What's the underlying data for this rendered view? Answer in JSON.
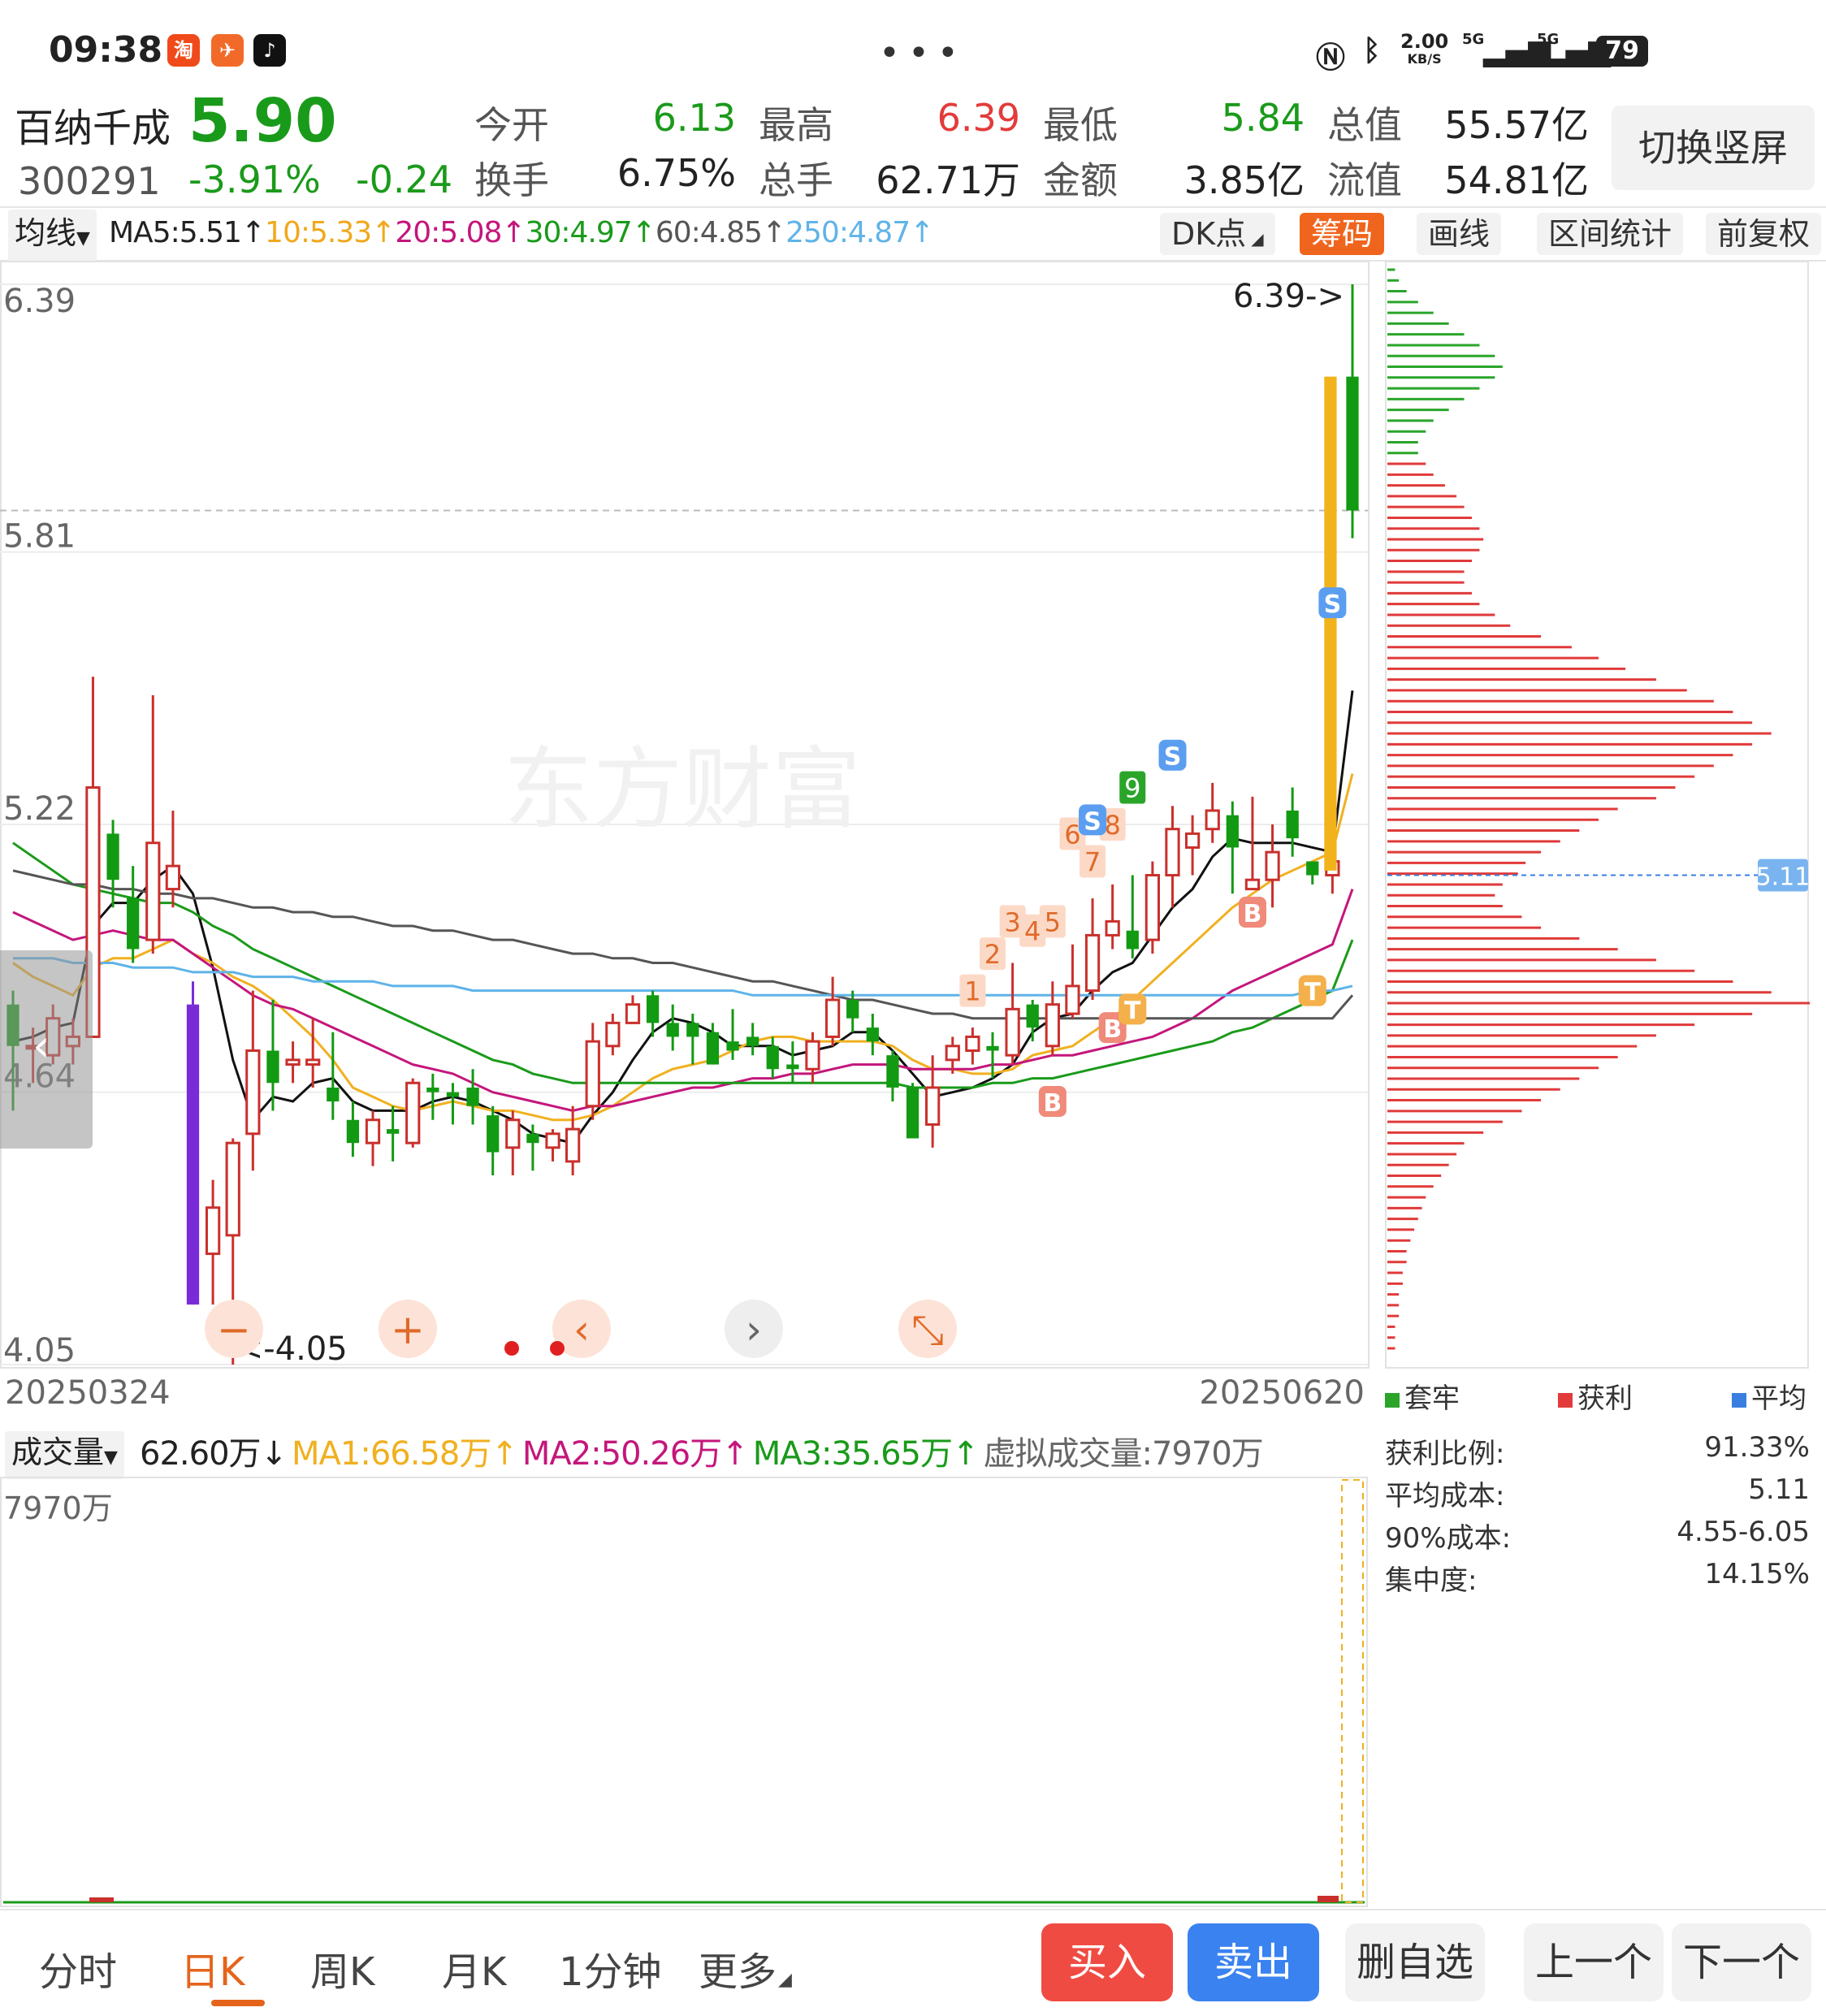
{
  "status_bar": {
    "time": "09:38",
    "app_icons": [
      "taobao-icon",
      "fliggy-icon",
      "douyin-icon"
    ],
    "net_speed_value": "2.00",
    "net_speed_unit": "KB/S",
    "signal_label_1": "5G",
    "signal_label_2": "5G",
    "battery": "79"
  },
  "quote": {
    "name": "百纳千成",
    "code": "300291",
    "price": "5.90",
    "change_pct": "-3.91%",
    "change": "-0.24",
    "rows": [
      [
        {
          "label": "今开",
          "value": "6.13",
          "color": "#1a9a1a"
        },
        {
          "label": "最高",
          "value": "6.39",
          "color": "#e33b3b"
        },
        {
          "label": "最低",
          "value": "5.84",
          "color": "#1a9a1a"
        },
        {
          "label": "总值",
          "value": "55.57亿",
          "color": "#222"
        }
      ],
      [
        {
          "label": "换手",
          "value": "6.75%",
          "color": "#222"
        },
        {
          "label": "总手",
          "value": "62.71万",
          "color": "#222"
        },
        {
          "label": "金额",
          "value": "3.85亿",
          "color": "#222"
        },
        {
          "label": "流值",
          "value": "54.81亿",
          "color": "#222"
        }
      ]
    ],
    "switch_button": "切换竖屏"
  },
  "ma_bar": {
    "selector": "均线",
    "items": [
      {
        "text": "MA5:5.51↑",
        "color": "#222"
      },
      {
        "text": "10:5.33↑",
        "color": "#f0a81c"
      },
      {
        "text": "20:5.08↑",
        "color": "#c4167c"
      },
      {
        "text": "30:4.97↑",
        "color": "#1a9a1a"
      },
      {
        "text": "60:4.85↑",
        "color": "#555555"
      },
      {
        "text": "250:4.87↑",
        "color": "#5fb3e8"
      }
    ],
    "tools": [
      "DK点",
      "筹码",
      "画线",
      "区间统计",
      "前复权"
    ],
    "active_tool": "筹码"
  },
  "chart_data": {
    "type": "candlestick",
    "y_ticks": [
      "6.39",
      "5.81",
      "5.22",
      "4.64",
      "4.05"
    ],
    "ylim": [
      4.05,
      6.39
    ],
    "x_start_label": "20250324",
    "x_end_label": "20250620",
    "high_marker": "6.39->",
    "low_marker": "<-4.05",
    "watermark": "东方财富",
    "candles": [
      {
        "o": 4.83,
        "c": 4.74,
        "h": 4.86,
        "l": 4.6
      },
      {
        "o": 4.74,
        "c": 4.74,
        "h": 4.78,
        "l": 4.66
      },
      {
        "o": 4.72,
        "c": 4.8,
        "h": 4.83,
        "l": 4.7
      },
      {
        "o": 4.74,
        "c": 4.76,
        "h": 4.8,
        "l": 4.7
      },
      {
        "o": 4.76,
        "c": 5.3,
        "h": 5.54,
        "l": 4.76
      },
      {
        "o": 5.2,
        "c": 5.1,
        "h": 5.23,
        "l": 5.04
      },
      {
        "o": 5.06,
        "c": 4.95,
        "h": 5.13,
        "l": 4.92
      },
      {
        "o": 4.97,
        "c": 5.18,
        "h": 5.5,
        "l": 4.94
      },
      {
        "o": 5.08,
        "c": 5.13,
        "h": 5.25,
        "l": 5.04
      },
      {
        "o": 4.83,
        "c": 4.18,
        "h": 4.88,
        "l": 4.18
      },
      {
        "o": 4.29,
        "c": 4.39,
        "h": 4.45,
        "l": 4.18
      },
      {
        "o": 4.33,
        "c": 4.53,
        "h": 4.54,
        "l": 4.05
      },
      {
        "o": 4.55,
        "c": 4.73,
        "h": 4.86,
        "l": 4.47
      },
      {
        "o": 4.73,
        "c": 4.66,
        "h": 4.84,
        "l": 4.6
      },
      {
        "o": 4.7,
        "c": 4.71,
        "h": 4.75,
        "l": 4.66
      },
      {
        "o": 4.7,
        "c": 4.71,
        "h": 4.8,
        "l": 4.65
      },
      {
        "o": 4.65,
        "c": 4.62,
        "h": 4.77,
        "l": 4.58
      },
      {
        "o": 4.58,
        "c": 4.53,
        "h": 4.62,
        "l": 4.5
      },
      {
        "o": 4.53,
        "c": 4.58,
        "h": 4.6,
        "l": 4.48
      },
      {
        "o": 4.56,
        "c": 4.55,
        "h": 4.61,
        "l": 4.49
      },
      {
        "o": 4.53,
        "c": 4.66,
        "h": 4.67,
        "l": 4.52
      },
      {
        "o": 4.65,
        "c": 4.64,
        "h": 4.68,
        "l": 4.58
      },
      {
        "o": 4.64,
        "c": 4.63,
        "h": 4.66,
        "l": 4.57
      },
      {
        "o": 4.65,
        "c": 4.61,
        "h": 4.69,
        "l": 4.57
      },
      {
        "o": 4.59,
        "c": 4.51,
        "h": 4.61,
        "l": 4.46
      },
      {
        "o": 4.52,
        "c": 4.58,
        "h": 4.6,
        "l": 4.46
      },
      {
        "o": 4.55,
        "c": 4.53,
        "h": 4.57,
        "l": 4.47
      },
      {
        "o": 4.52,
        "c": 4.55,
        "h": 4.56,
        "l": 4.49
      },
      {
        "o": 4.49,
        "c": 4.56,
        "h": 4.61,
        "l": 4.46
      },
      {
        "o": 4.61,
        "c": 4.75,
        "h": 4.79,
        "l": 4.58
      },
      {
        "o": 4.74,
        "c": 4.79,
        "h": 4.81,
        "l": 4.72
      },
      {
        "o": 4.79,
        "c": 4.83,
        "h": 4.85,
        "l": 4.79
      },
      {
        "o": 4.85,
        "c": 4.79,
        "h": 4.86,
        "l": 4.76
      },
      {
        "o": 4.79,
        "c": 4.76,
        "h": 4.83,
        "l": 4.73
      },
      {
        "o": 4.79,
        "c": 4.76,
        "h": 4.81,
        "l": 4.7
      },
      {
        "o": 4.77,
        "c": 4.7,
        "h": 4.79,
        "l": 4.7
      },
      {
        "o": 4.75,
        "c": 4.73,
        "h": 4.82,
        "l": 4.71
      },
      {
        "o": 4.76,
        "c": 4.74,
        "h": 4.79,
        "l": 4.72
      },
      {
        "o": 4.74,
        "c": 4.69,
        "h": 4.76,
        "l": 4.67
      },
      {
        "o": 4.7,
        "c": 4.69,
        "h": 4.75,
        "l": 4.66
      },
      {
        "o": 4.69,
        "c": 4.75,
        "h": 4.77,
        "l": 4.66
      },
      {
        "o": 4.76,
        "c": 4.84,
        "h": 4.89,
        "l": 4.74
      },
      {
        "o": 4.84,
        "c": 4.8,
        "h": 4.86,
        "l": 4.77
      },
      {
        "o": 4.78,
        "c": 4.75,
        "h": 4.81,
        "l": 4.72
      },
      {
        "o": 4.72,
        "c": 4.65,
        "h": 4.73,
        "l": 4.62
      },
      {
        "o": 4.65,
        "c": 4.54,
        "h": 4.66,
        "l": 4.54
      },
      {
        "o": 4.57,
        "c": 4.65,
        "h": 4.72,
        "l": 4.52
      },
      {
        "o": 4.71,
        "c": 4.74,
        "h": 4.76,
        "l": 4.68
      },
      {
        "o": 4.73,
        "c": 4.76,
        "h": 4.78,
        "l": 4.7
      },
      {
        "o": 4.74,
        "c": 4.73,
        "h": 4.77,
        "l": 4.67
      },
      {
        "o": 4.72,
        "c": 4.82,
        "h": 4.92,
        "l": 4.7
      },
      {
        "o": 4.83,
        "c": 4.78,
        "h": 4.84,
        "l": 4.75
      },
      {
        "o": 4.74,
        "c": 4.83,
        "h": 4.88,
        "l": 4.72
      },
      {
        "o": 4.81,
        "c": 4.87,
        "h": 4.96,
        "l": 4.8
      },
      {
        "o": 4.86,
        "c": 4.98,
        "h": 5.06,
        "l": 4.84
      },
      {
        "o": 4.98,
        "c": 5.01,
        "h": 5.09,
        "l": 4.95
      },
      {
        "o": 4.99,
        "c": 4.95,
        "h": 5.11,
        "l": 4.93
      },
      {
        "o": 4.97,
        "c": 5.11,
        "h": 5.14,
        "l": 4.94
      },
      {
        "o": 5.11,
        "c": 5.21,
        "h": 5.26,
        "l": 5.04
      },
      {
        "o": 5.17,
        "c": 5.2,
        "h": 5.24,
        "l": 5.11
      },
      {
        "o": 5.21,
        "c": 5.25,
        "h": 5.31,
        "l": 5.18
      },
      {
        "o": 5.24,
        "c": 5.17,
        "h": 5.27,
        "l": 5.07
      },
      {
        "o": 5.08,
        "c": 5.1,
        "h": 5.28,
        "l": 5.08
      },
      {
        "o": 5.1,
        "c": 5.16,
        "h": 5.22,
        "l": 5.04
      },
      {
        "o": 5.25,
        "c": 5.19,
        "h": 5.3,
        "l": 5.15
      },
      {
        "o": 5.14,
        "c": 5.11,
        "h": 5.13,
        "l": 5.09
      },
      {
        "o": 5.11,
        "c": 5.14,
        "h": 5.18,
        "l": 5.07
      },
      {
        "o": 6.19,
        "c": 5.9,
        "h": 6.39,
        "l": 5.84
      }
    ],
    "ma_lines": [
      {
        "name": "MA5",
        "color": "#111111",
        "values": [
          4.75,
          4.76,
          4.78,
          4.79,
          5.0,
          5.05,
          5.05,
          5.1,
          5.13,
          5.07,
          4.91,
          4.71,
          4.58,
          4.63,
          4.62,
          4.66,
          4.67,
          4.62,
          4.6,
          4.6,
          4.6,
          4.62,
          4.63,
          4.62,
          4.6,
          4.58,
          4.55,
          4.54,
          4.53,
          4.59,
          4.64,
          4.71,
          4.77,
          4.8,
          4.79,
          4.77,
          4.74,
          4.74,
          4.74,
          4.72,
          4.73,
          4.74,
          4.77,
          4.77,
          4.73,
          4.68,
          4.63,
          4.64,
          4.65,
          4.67,
          4.7,
          4.77,
          4.8,
          4.81,
          4.86,
          4.9,
          4.92,
          4.98,
          5.04,
          5.08,
          5.15,
          5.19,
          5.18,
          5.18,
          5.18,
          5.17,
          5.16,
          5.51
        ]
      },
      {
        "name": "MA10",
        "color": "#f0b020",
        "values": [
          4.92,
          4.89,
          4.87,
          4.85,
          4.91,
          4.93,
          4.93,
          4.95,
          4.97,
          4.94,
          4.92,
          4.89,
          4.87,
          4.84,
          4.8,
          4.76,
          4.71,
          4.65,
          4.63,
          4.61,
          4.6,
          4.61,
          4.62,
          4.61,
          4.6,
          4.6,
          4.59,
          4.58,
          4.58,
          4.59,
          4.61,
          4.64,
          4.67,
          4.69,
          4.7,
          4.71,
          4.73,
          4.75,
          4.76,
          4.76,
          4.75,
          4.75,
          4.75,
          4.75,
          4.74,
          4.71,
          4.69,
          4.69,
          4.68,
          4.68,
          4.69,
          4.72,
          4.73,
          4.74,
          4.77,
          4.8,
          4.84,
          4.88,
          4.92,
          4.96,
          5.0,
          5.04,
          5.07,
          5.1,
          5.12,
          5.14,
          5.16,
          5.33
        ]
      },
      {
        "name": "MA20",
        "color": "#c4167c",
        "values": [
          5.03,
          5.01,
          4.99,
          4.97,
          4.98,
          4.99,
          4.98,
          4.97,
          4.97,
          4.94,
          4.91,
          4.88,
          4.85,
          4.83,
          4.82,
          4.8,
          4.78,
          4.76,
          4.74,
          4.72,
          4.7,
          4.69,
          4.68,
          4.66,
          4.64,
          4.63,
          4.62,
          4.61,
          4.6,
          4.61,
          4.61,
          4.62,
          4.63,
          4.64,
          4.65,
          4.65,
          4.66,
          4.67,
          4.67,
          4.68,
          4.68,
          4.69,
          4.7,
          4.7,
          4.7,
          4.69,
          4.69,
          4.69,
          4.69,
          4.7,
          4.7,
          4.71,
          4.72,
          4.72,
          4.73,
          4.74,
          4.75,
          4.76,
          4.78,
          4.8,
          4.83,
          4.86,
          4.88,
          4.9,
          4.92,
          4.94,
          4.96,
          5.08
        ]
      },
      {
        "name": "MA30",
        "color": "#1a9a1a",
        "values": [
          5.18,
          5.15,
          5.12,
          5.09,
          5.08,
          5.07,
          5.06,
          5.05,
          5.05,
          5.03,
          5.0,
          4.98,
          4.95,
          4.93,
          4.91,
          4.89,
          4.87,
          4.85,
          4.83,
          4.81,
          4.79,
          4.77,
          4.75,
          4.73,
          4.71,
          4.7,
          4.68,
          4.67,
          4.66,
          4.66,
          4.66,
          4.66,
          4.66,
          4.66,
          4.66,
          4.66,
          4.66,
          4.66,
          4.66,
          4.66,
          4.66,
          4.66,
          4.66,
          4.66,
          4.66,
          4.65,
          4.65,
          4.65,
          4.65,
          4.66,
          4.66,
          4.67,
          4.67,
          4.68,
          4.69,
          4.7,
          4.71,
          4.72,
          4.73,
          4.74,
          4.75,
          4.77,
          4.78,
          4.8,
          4.82,
          4.84,
          4.86,
          4.97
        ]
      },
      {
        "name": "MA60",
        "color": "#555555",
        "values": [
          5.12,
          5.11,
          5.1,
          5.09,
          5.09,
          5.08,
          5.08,
          5.07,
          5.07,
          5.06,
          5.06,
          5.05,
          5.04,
          5.04,
          5.03,
          5.03,
          5.02,
          5.02,
          5.01,
          5.0,
          5.0,
          4.99,
          4.99,
          4.98,
          4.97,
          4.97,
          4.96,
          4.95,
          4.94,
          4.94,
          4.93,
          4.93,
          4.92,
          4.92,
          4.91,
          4.9,
          4.89,
          4.88,
          4.88,
          4.87,
          4.86,
          4.85,
          4.84,
          4.84,
          4.83,
          4.82,
          4.81,
          4.81,
          4.8,
          4.8,
          4.8,
          4.8,
          4.8,
          4.8,
          4.8,
          4.8,
          4.8,
          4.8,
          4.8,
          4.8,
          4.8,
          4.8,
          4.8,
          4.8,
          4.8,
          4.8,
          4.8,
          4.85
        ]
      },
      {
        "name": "MA250",
        "color": "#5fb3e8",
        "values": [
          4.93,
          4.93,
          4.93,
          4.92,
          4.92,
          4.92,
          4.91,
          4.91,
          4.91,
          4.9,
          4.9,
          4.9,
          4.89,
          4.89,
          4.89,
          4.88,
          4.88,
          4.88,
          4.88,
          4.87,
          4.87,
          4.87,
          4.87,
          4.86,
          4.86,
          4.86,
          4.86,
          4.86,
          4.86,
          4.86,
          4.86,
          4.86,
          4.86,
          4.86,
          4.86,
          4.86,
          4.86,
          4.85,
          4.85,
          4.85,
          4.85,
          4.85,
          4.85,
          4.85,
          4.85,
          4.85,
          4.85,
          4.85,
          4.85,
          4.85,
          4.85,
          4.85,
          4.85,
          4.85,
          4.85,
          4.85,
          4.85,
          4.85,
          4.85,
          4.85,
          4.85,
          4.85,
          4.85,
          4.85,
          4.85,
          4.86,
          4.86,
          4.87
        ]
      }
    ],
    "dk_labels": [
      {
        "i": 48,
        "text": "1",
        "price": 4.86
      },
      {
        "i": 49,
        "text": "2",
        "price": 4.94
      },
      {
        "i": 50,
        "text": "3",
        "price": 5.01
      },
      {
        "i": 51,
        "text": "4",
        "price": 4.99
      },
      {
        "i": 52,
        "text": "5",
        "price": 5.01
      },
      {
        "i": 53,
        "text": "6",
        "price": 5.2
      },
      {
        "i": 54,
        "text": "7",
        "price": 5.14
      },
      {
        "i": 55,
        "text": "8",
        "price": 5.22
      },
      {
        "i": 56,
        "text": "9",
        "price": 5.3
      }
    ],
    "signals": [
      {
        "i": 54,
        "text": "S",
        "kind": "sell",
        "price": 5.23
      },
      {
        "i": 58,
        "text": "S",
        "kind": "sell",
        "price": 5.37
      },
      {
        "i": 66,
        "text": "S",
        "kind": "sell",
        "price": 5.7
      },
      {
        "i": 52,
        "text": "B",
        "kind": "buy",
        "price": 4.62
      },
      {
        "i": 55,
        "text": "B",
        "kind": "buy",
        "price": 4.78
      },
      {
        "i": 62,
        "text": "B",
        "kind": "buy",
        "price": 5.03
      },
      {
        "i": 56,
        "text": "T",
        "kind": "t",
        "price": 4.82
      },
      {
        "i": 65,
        "text": "T",
        "kind": "t",
        "price": 4.86
      }
    ],
    "chips": {
      "avg_cost_label": "5.11",
      "profit_levels_from_top": 50,
      "values": [
        2,
        3,
        5,
        8,
        12,
        16,
        20,
        24,
        28,
        30,
        28,
        24,
        20,
        16,
        12,
        10,
        8,
        8,
        10,
        12,
        15,
        18,
        20,
        22,
        24,
        25,
        24,
        22,
        20,
        20,
        22,
        24,
        28,
        32,
        40,
        48,
        55,
        62,
        70,
        78,
        85,
        90,
        95,
        100,
        95,
        90,
        85,
        80,
        75,
        70,
        60,
        55,
        50,
        45,
        40,
        36,
        34,
        30,
        28,
        30,
        35,
        40,
        50,
        60,
        70,
        80,
        90,
        100,
        110,
        95,
        80,
        70,
        65,
        60,
        55,
        50,
        45,
        40,
        35,
        30,
        25,
        20,
        18,
        16,
        14,
        12,
        10,
        9,
        8,
        7,
        6,
        5,
        5,
        4,
        4,
        3,
        3,
        3,
        2,
        2,
        2
      ]
    }
  },
  "chart_controls": [
    "minus-icon",
    "plus-icon",
    "chevron-left-icon",
    "chevron-right-icon",
    "collapse-icon"
  ],
  "volume_panel": {
    "selector": "成交量",
    "items": [
      {
        "text": "62.60万↓",
        "color": "#222"
      },
      {
        "text": "MA1:66.58万↑",
        "color": "#f0b020"
      },
      {
        "text": "MA2:50.26万↑",
        "color": "#c4167c"
      },
      {
        "text": "MA3:35.65万↑",
        "color": "#1a9a1a"
      },
      {
        "text": "虚拟成交量:7970万",
        "color": "#666"
      }
    ],
    "y_top_label": "7970万"
  },
  "chip_info": {
    "legend": [
      {
        "label": "套牢",
        "color": "#2aa52a"
      },
      {
        "label": "获利",
        "color": "#e33b3b"
      },
      {
        "label": "平均",
        "color": "#3a7fe0"
      }
    ],
    "rows": [
      {
        "label": "获利比例:",
        "value": "91.33%"
      },
      {
        "label": "平均成本:",
        "value": "5.11"
      },
      {
        "label": "90%成本:",
        "value": "4.55-6.05"
      },
      {
        "label": "集中度:",
        "value": "14.15%"
      }
    ]
  },
  "bottom_nav": {
    "tabs": [
      "分时",
      "日K",
      "周K",
      "月K",
      "1分钟",
      "更多"
    ],
    "active": "日K",
    "buy": "买入",
    "sell": "卖出",
    "actions": [
      "删自选",
      "上一个",
      "下一个"
    ]
  }
}
